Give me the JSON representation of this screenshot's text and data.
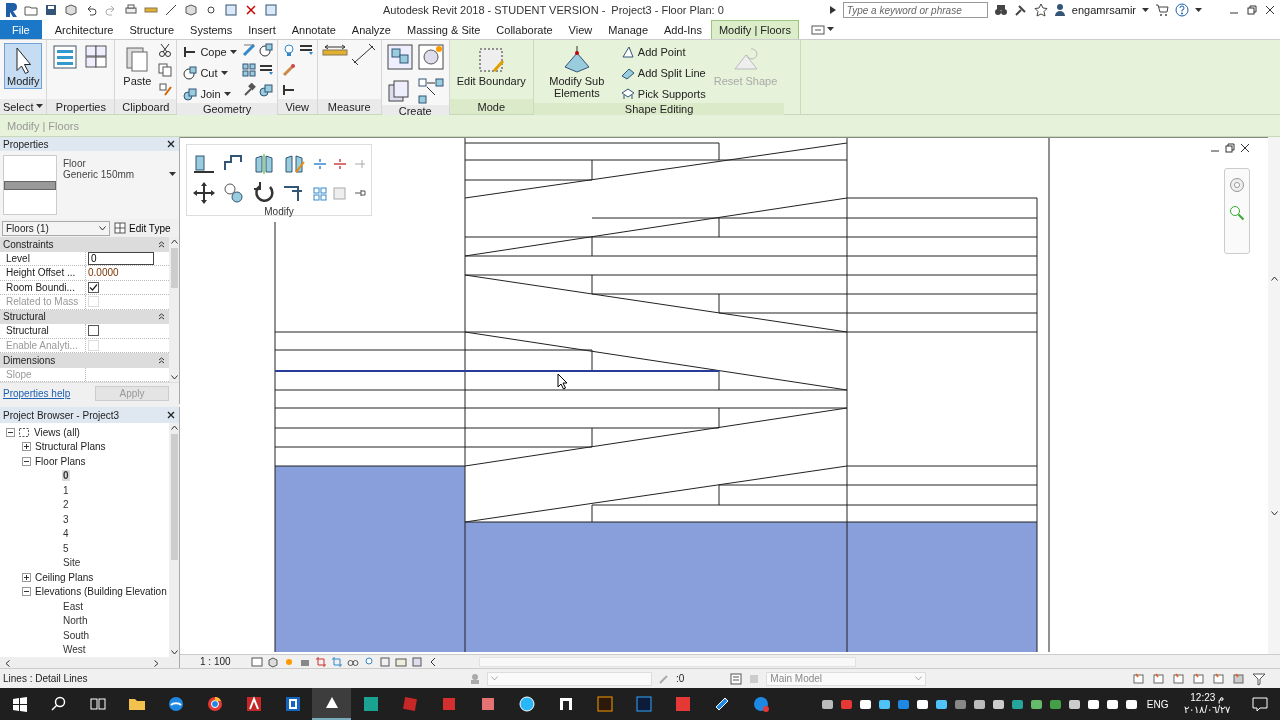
{
  "title_bar": {
    "title": "Autodesk Revit 2018 - STUDENT VERSION -",
    "document": "Project3 - Floor Plan: 0",
    "search": {
      "placeholder": "Type a keyword or phrase"
    },
    "user": "engamrsamir"
  },
  "ribbon_tabs": [
    {
      "label": "File",
      "kind": "file",
      "selected": false
    },
    {
      "label": "Architecture",
      "kind": "tab",
      "selected": false
    },
    {
      "label": "Structure",
      "kind": "tab",
      "selected": false
    },
    {
      "label": "Systems",
      "kind": "tab",
      "selected": false
    },
    {
      "label": "Insert",
      "kind": "tab",
      "selected": false
    },
    {
      "label": "Annotate",
      "kind": "tab",
      "selected": false
    },
    {
      "label": "Analyze",
      "kind": "tab",
      "selected": false
    },
    {
      "label": "Massing & Site",
      "kind": "tab",
      "selected": false
    },
    {
      "label": "Collaborate",
      "kind": "tab",
      "selected": false
    },
    {
      "label": "View",
      "kind": "tab",
      "selected": false
    },
    {
      "label": "Manage",
      "kind": "tab",
      "selected": false
    },
    {
      "label": "Add-Ins",
      "kind": "tab",
      "selected": false
    },
    {
      "label": "Modify | Floors",
      "kind": "tab",
      "selected": true
    }
  ],
  "ribbon_panels": [
    {
      "title": "Select",
      "kind": "standard",
      "tools": [
        {
          "kind": "large",
          "label": "Modify",
          "selected": true,
          "disabled": false
        }
      ]
    },
    {
      "title": "Properties",
      "kind": "standard"
    },
    {
      "title": "Clipboard",
      "kind": "standard",
      "tools": [
        {
          "kind": "large",
          "label": "Paste",
          "selected": false,
          "disabled": false
        }
      ]
    },
    {
      "title": "Geometry",
      "kind": "standard",
      "tools": [
        {
          "kind": "small",
          "label": "Cope",
          "disabled": false
        },
        {
          "kind": "small",
          "label": "Cut",
          "disabled": false
        },
        {
          "kind": "small",
          "label": "Join",
          "disabled": false
        }
      ]
    },
    {
      "title": "View",
      "kind": "standard"
    },
    {
      "title": "Measure",
      "kind": "standard"
    },
    {
      "title": "Create",
      "kind": "standard"
    },
    {
      "title": "Mode",
      "kind": "contextual",
      "tools": [
        {
          "kind": "large",
          "label": "Edit Boundary",
          "selected": false,
          "disabled": false
        }
      ]
    },
    {
      "title": "Shape Editing",
      "kind": "contextual",
      "tools": [
        {
          "kind": "large",
          "label": "Modify Sub Elements",
          "selected": false,
          "disabled": false
        },
        {
          "kind": "small",
          "label": "Add Point",
          "disabled": false
        },
        {
          "kind": "small",
          "label": "Add Split Line",
          "disabled": false
        },
        {
          "kind": "small",
          "label": "Pick Supports",
          "disabled": false
        },
        {
          "kind": "large",
          "label": "Reset Shape",
          "selected": false,
          "disabled": true
        }
      ]
    }
  ],
  "options_bar": {
    "label": "Modify | Floors"
  },
  "properties": {
    "title": "Properties",
    "type_name": "Floor",
    "type_detail": "Generic 150mm",
    "selector": "Floors (1)",
    "edit_type": "Edit Type",
    "groups": [
      {
        "title": "Constraints",
        "rows": [
          {
            "label": "Level",
            "kind": "field",
            "value": "0",
            "disabled": false
          },
          {
            "label": "Height Offset ...",
            "kind": "text",
            "value": "0.0000",
            "disabled": false
          },
          {
            "label": "Room Boundi...",
            "kind": "checkbox",
            "checked": true,
            "disabled": false
          },
          {
            "label": "Related to Mass",
            "kind": "checkbox",
            "checked": false,
            "disabled": true
          }
        ]
      },
      {
        "title": "Structural",
        "rows": [
          {
            "label": "Structural",
            "kind": "checkbox",
            "checked": false,
            "disabled": false
          },
          {
            "label": "Enable Analyti...",
            "kind": "checkbox",
            "checked": false,
            "disabled": true
          }
        ]
      },
      {
        "title": "Dimensions",
        "rows": [
          {
            "label": "Slope",
            "kind": "text",
            "disabled": true
          }
        ]
      }
    ],
    "help": "Properties help",
    "apply": {
      "label": "Apply",
      "disabled": true
    }
  },
  "project_browser": {
    "title": "Project Browser - Project3",
    "tree": [
      {
        "label": "Views (all)",
        "kind": "root",
        "expanded": true,
        "selected": false,
        "children": [
          {
            "label": "Structural Plans",
            "kind": "folder",
            "expanded": false,
            "selected": false
          },
          {
            "label": "Floor Plans",
            "kind": "folder",
            "expanded": true,
            "selected": false,
            "children": [
              {
                "label": "0",
                "kind": "view",
                "selected": true
              },
              {
                "label": "1",
                "kind": "view",
                "selected": false
              },
              {
                "label": "2",
                "kind": "view",
                "selected": false
              },
              {
                "label": "3",
                "kind": "view",
                "selected": false
              },
              {
                "label": "4",
                "kind": "view",
                "selected": false
              },
              {
                "label": "5",
                "kind": "view",
                "selected": false
              },
              {
                "label": "Site",
                "kind": "view",
                "selected": false
              }
            ]
          },
          {
            "label": "Ceiling Plans",
            "kind": "folder",
            "expanded": false,
            "selected": false
          },
          {
            "label": "Elevations (Building Elevation",
            "kind": "folder",
            "expanded": true,
            "selected": false,
            "children": [
              {
                "label": "East",
                "kind": "view",
                "selected": false
              },
              {
                "label": "North",
                "kind": "view",
                "selected": false
              },
              {
                "label": "South",
                "kind": "view",
                "selected": false
              },
              {
                "label": "West",
                "kind": "view",
                "selected": false
              }
            ]
          }
        ]
      }
    ]
  },
  "canvas": {
    "modify_panel": {
      "title": "Modify"
    },
    "scale": "1 : 100"
  },
  "status_bar": {
    "message": "Lines : Detail Lines",
    "workset": ":0",
    "model": "Main Model"
  },
  "taskbar": {
    "language": "ENG",
    "time": "12:23 م",
    "date": "٢٠١٨/٠٦/٢٧"
  }
}
